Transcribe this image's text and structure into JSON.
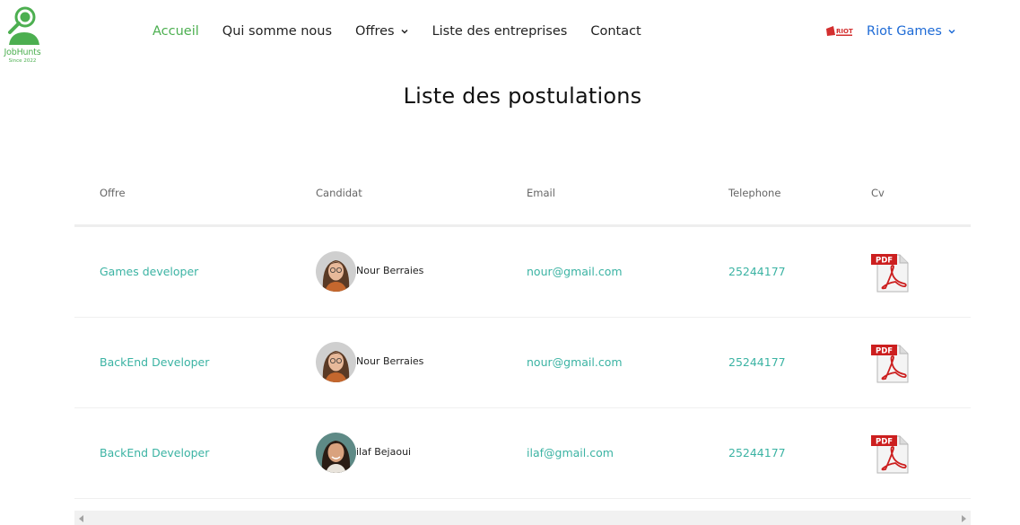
{
  "brand": {
    "name": "JobHunts",
    "since": "Since 2022",
    "color": "#4caf50"
  },
  "nav": {
    "items": [
      {
        "label": "Accueil",
        "active": true
      },
      {
        "label": "Qui somme nous"
      },
      {
        "label": "Offres",
        "dropdown": true
      },
      {
        "label": "Liste des entreprises"
      },
      {
        "label": "Contact"
      }
    ]
  },
  "company": {
    "label": "Riot Games",
    "logo_text": "RIOT",
    "color": "#1e6bd6"
  },
  "page": {
    "title": "Liste des postulations"
  },
  "table": {
    "headers": [
      "Offre",
      "Candidat",
      "Email",
      "Telephone",
      "Cv"
    ],
    "rows": [
      {
        "offre": "Games developer",
        "candidat": "Nour Berraies",
        "email": "nour@gmail.com",
        "telephone": "25244177",
        "cv": "PDF",
        "avatar": "avatar-woman-glasses"
      },
      {
        "offre": "BackEnd Developer",
        "candidat": "Nour Berraies",
        "email": "nour@gmail.com",
        "telephone": "25244177",
        "cv": "PDF",
        "avatar": "avatar-woman-glasses"
      },
      {
        "offre": "BackEnd Developer",
        "candidat": "ilaf Bejaoui",
        "email": "ilaf@gmail.com",
        "telephone": "25244177",
        "cv": "PDF",
        "avatar": "avatar-woman-smiling"
      }
    ]
  },
  "colors": {
    "link": "#3bb3a3",
    "active_nav": "#4caf50",
    "pdf_red": "#cc1f1f"
  }
}
